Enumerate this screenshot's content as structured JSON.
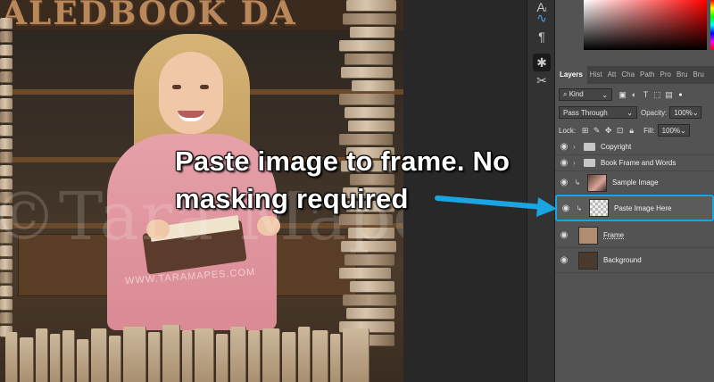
{
  "canvas": {
    "banner_text": "ALEDBOOK DA",
    "watermark": "©Tara Mapes",
    "watermark_url": "WWW.TARAMAPES.COM"
  },
  "callout": {
    "line1": "Paste image to frame. No",
    "line2": "masking required",
    "arrow_color": "#1aa4e0"
  },
  "toolbar": {
    "icons": [
      "text-on-path-icon",
      "curve-icon",
      "paragraph-icon",
      "layers-3d-icon",
      "tools-icon"
    ]
  },
  "panels": {
    "tabs": [
      "Layers",
      "Hist",
      "Att",
      "Cha",
      "Path",
      "Pro",
      "Bru",
      "Bru"
    ],
    "filter": {
      "kind_label": "Kind"
    },
    "blend": {
      "mode": "Pass Through",
      "opacity_label": "Opacity:",
      "opacity_value": "100%"
    },
    "lock": {
      "label": "Lock:",
      "fill_label": "Fill:",
      "fill_value": "100%"
    },
    "layers": [
      {
        "name": "Copyright",
        "type": "group",
        "selected": false
      },
      {
        "name": "Book Frame and Words",
        "type": "group",
        "selected": false
      },
      {
        "name": "Sample Image",
        "type": "image",
        "clipped": true,
        "selected": false
      },
      {
        "name": "Paste Image Here",
        "type": "transparent",
        "clipped": true,
        "selected": true
      },
      {
        "name": "Frame",
        "type": "texture",
        "selected": false
      },
      {
        "name": "Background",
        "type": "texture",
        "selected": false
      }
    ],
    "selection_color": "#1aa4e0"
  }
}
